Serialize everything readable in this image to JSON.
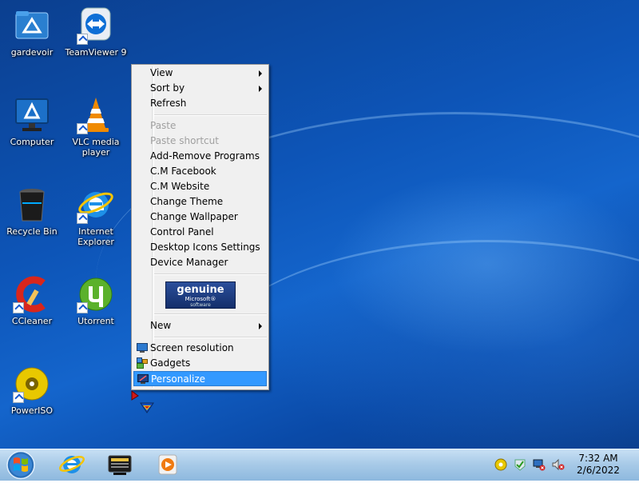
{
  "desktop_icons": [
    {
      "label": "gardevoir",
      "icon": "folder-icon"
    },
    {
      "label": "TeamViewer 9",
      "icon": "teamviewer-icon"
    },
    {
      "label": "Computer",
      "icon": "computer-icon"
    },
    {
      "label": "VLC media player",
      "icon": "vlc-icon"
    },
    {
      "label": "Recycle Bin",
      "icon": "recycle-bin-icon"
    },
    {
      "label": "Internet Explorer",
      "icon": "internet-explorer-icon"
    },
    {
      "label": "CCleaner",
      "icon": "ccleaner-icon"
    },
    {
      "label": "Utorrent",
      "icon": "utorrent-icon"
    },
    {
      "label": "PowerISO",
      "icon": "poweriso-icon"
    }
  ],
  "context_menu": {
    "items": [
      {
        "label": "View",
        "submenu": true
      },
      {
        "label": "Sort by",
        "submenu": true
      },
      {
        "label": "Refresh"
      },
      {
        "label": "Paste",
        "disabled": true
      },
      {
        "label": "Paste shortcut",
        "disabled": true
      },
      {
        "label": "Add-Remove Programs"
      },
      {
        "label": "C.M Facebook"
      },
      {
        "label": "C.M Website"
      },
      {
        "label": "Change Theme"
      },
      {
        "label": "Change Wallpaper"
      },
      {
        "label": "Control Panel"
      },
      {
        "label": "Desktop Icons Settings"
      },
      {
        "label": "Device Manager"
      },
      {
        "label": "New",
        "submenu": true
      },
      {
        "label": "Screen resolution",
        "icon": "screen-resolution-icon"
      },
      {
        "label": "Gadgets",
        "icon": "gadgets-icon"
      },
      {
        "label": "Personalize",
        "icon": "personalize-icon",
        "selected": true
      }
    ],
    "genuine_badge": {
      "line1": "genuine",
      "line2": "Microsoft®",
      "line3": "software"
    }
  },
  "taskbar": {
    "pinned": [
      "internet-explorer-icon",
      "file-manager-icon",
      "media-player-icon"
    ],
    "tray_icons": [
      "app-tray-icon",
      "action-center-icon",
      "network-icon",
      "volume-muted-icon"
    ],
    "clock": {
      "time": "7:32 AM",
      "date": "2/6/2022"
    }
  },
  "colors": {
    "selection": "#3399ff",
    "taskbar": "#a9cbe8",
    "desktop": "#0d55b8"
  }
}
